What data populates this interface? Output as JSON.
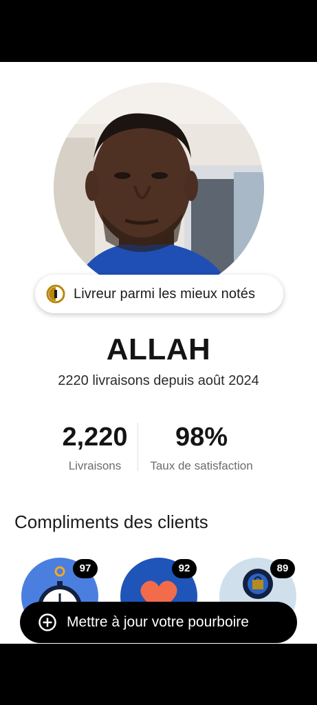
{
  "profile": {
    "badge_label": "Livreur parmi les mieux notés",
    "name": "ALLAH",
    "subtitle": "2220 livraisons depuis août 2024"
  },
  "stats": [
    {
      "value": "2,220",
      "label": "Livraisons"
    },
    {
      "value": "98%",
      "label": "Taux de satisfaction"
    }
  ],
  "compliments": {
    "title": "Compliments des clients",
    "items": [
      {
        "icon": "stopwatch-icon",
        "count": "97"
      },
      {
        "icon": "heart-icon",
        "count": "92"
      },
      {
        "icon": "shopping-bag-icon",
        "count": "89"
      }
    ]
  },
  "cta": {
    "label": "Mettre à jour votre pourboire",
    "icon": "plus-circle-icon"
  },
  "colors": {
    "accent_gold": "#b8860b",
    "black": "#000000",
    "white": "#ffffff"
  }
}
